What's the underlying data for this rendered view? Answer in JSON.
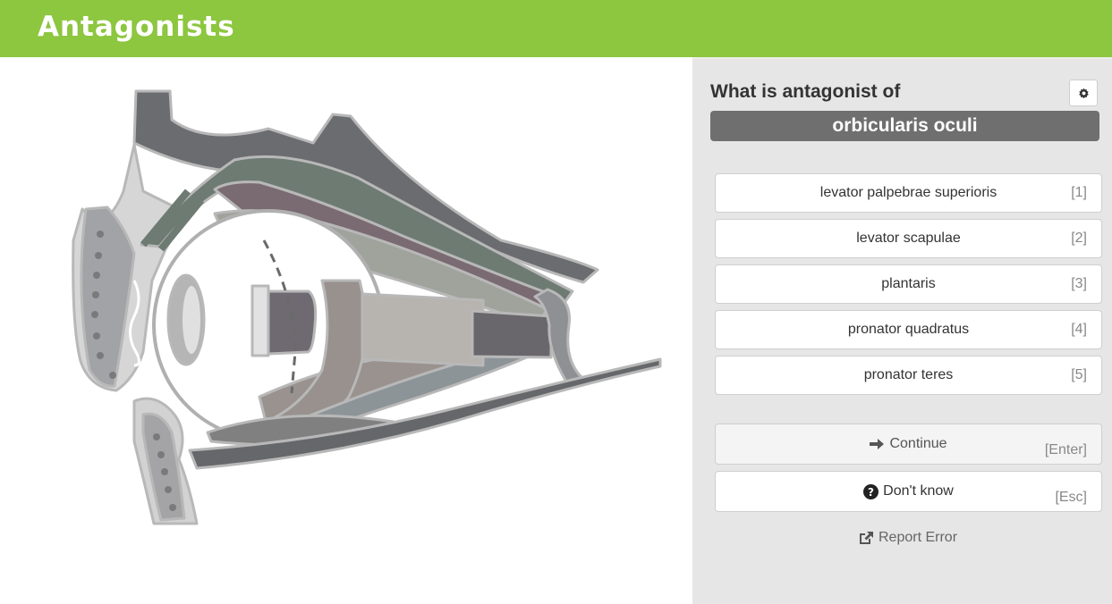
{
  "app": {
    "title": "Antagonists"
  },
  "quiz": {
    "question": "What is antagonist of",
    "term": "orbicularis oculi",
    "answers": [
      {
        "label": "levator palpebrae superioris",
        "key": "[1]"
      },
      {
        "label": "levator scapulae",
        "key": "[2]"
      },
      {
        "label": "plantaris",
        "key": "[3]"
      },
      {
        "label": "pronator quadratus",
        "key": "[4]"
      },
      {
        "label": "pronator teres",
        "key": "[5]"
      }
    ]
  },
  "actions": {
    "continue": {
      "label": "Continue",
      "key": "[Enter]",
      "icon": "arrow-right-icon"
    },
    "dont_know": {
      "label": "Don't know",
      "key": "[Esc]",
      "icon": "question-circle-icon"
    },
    "report": {
      "label": "Report Error",
      "icon": "external-link-icon"
    },
    "settings": {
      "icon": "gear-icon"
    }
  },
  "colors": {
    "brand": "#8dc63f",
    "term_bg": "#6f6f6f",
    "panel_bg": "#e6e6e6"
  }
}
